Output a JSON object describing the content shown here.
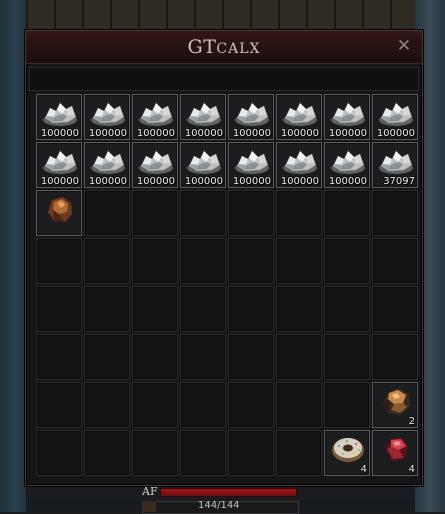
{
  "window": {
    "title_main": "GT",
    "title_small": "CALX",
    "close_icon": "close-icon"
  },
  "inventory": {
    "slots": [
      {
        "item": "silver-ore-icon",
        "qty": "100000"
      },
      {
        "item": "silver-ore-icon",
        "qty": "100000"
      },
      {
        "item": "silver-ore-icon",
        "qty": "100000"
      },
      {
        "item": "silver-ore-icon",
        "qty": "100000"
      },
      {
        "item": "silver-ore-icon",
        "qty": "100000"
      },
      {
        "item": "silver-ore-icon",
        "qty": "100000"
      },
      {
        "item": "silver-ore-icon",
        "qty": "100000"
      },
      {
        "item": "silver-ore-icon",
        "qty": "100000"
      },
      {
        "item": "silver-ore-icon",
        "qty": "100000"
      },
      {
        "item": "silver-ore-icon",
        "qty": "100000"
      },
      {
        "item": "silver-ore-icon",
        "qty": "100000"
      },
      {
        "item": "silver-ore-icon",
        "qty": "100000"
      },
      {
        "item": "silver-ore-icon",
        "qty": "100000"
      },
      {
        "item": "silver-ore-icon",
        "qty": "100000"
      },
      {
        "item": "silver-ore-icon",
        "qty": "100000"
      },
      {
        "item": "silver-ore-icon",
        "qty": "37097"
      },
      {
        "item": "copper-nugget-icon",
        "qty": ""
      },
      {},
      {},
      {},
      {},
      {},
      {},
      {},
      {},
      {},
      {},
      {},
      {},
      {},
      {},
      {},
      {},
      {},
      {},
      {},
      {},
      {},
      {},
      {},
      {},
      {},
      {},
      {},
      {},
      {},
      {},
      {},
      {},
      {},
      {},
      {},
      {},
      {},
      {},
      {
        "item": "copper-ore-icon",
        "qty": "2"
      },
      {},
      {},
      {},
      {},
      {},
      {},
      {
        "item": "frosted-donut-icon",
        "qty": "4"
      },
      {
        "item": "red-gem-icon",
        "qty": "4"
      }
    ]
  },
  "hud": {
    "label": "AF",
    "hp_text": "144/144"
  }
}
